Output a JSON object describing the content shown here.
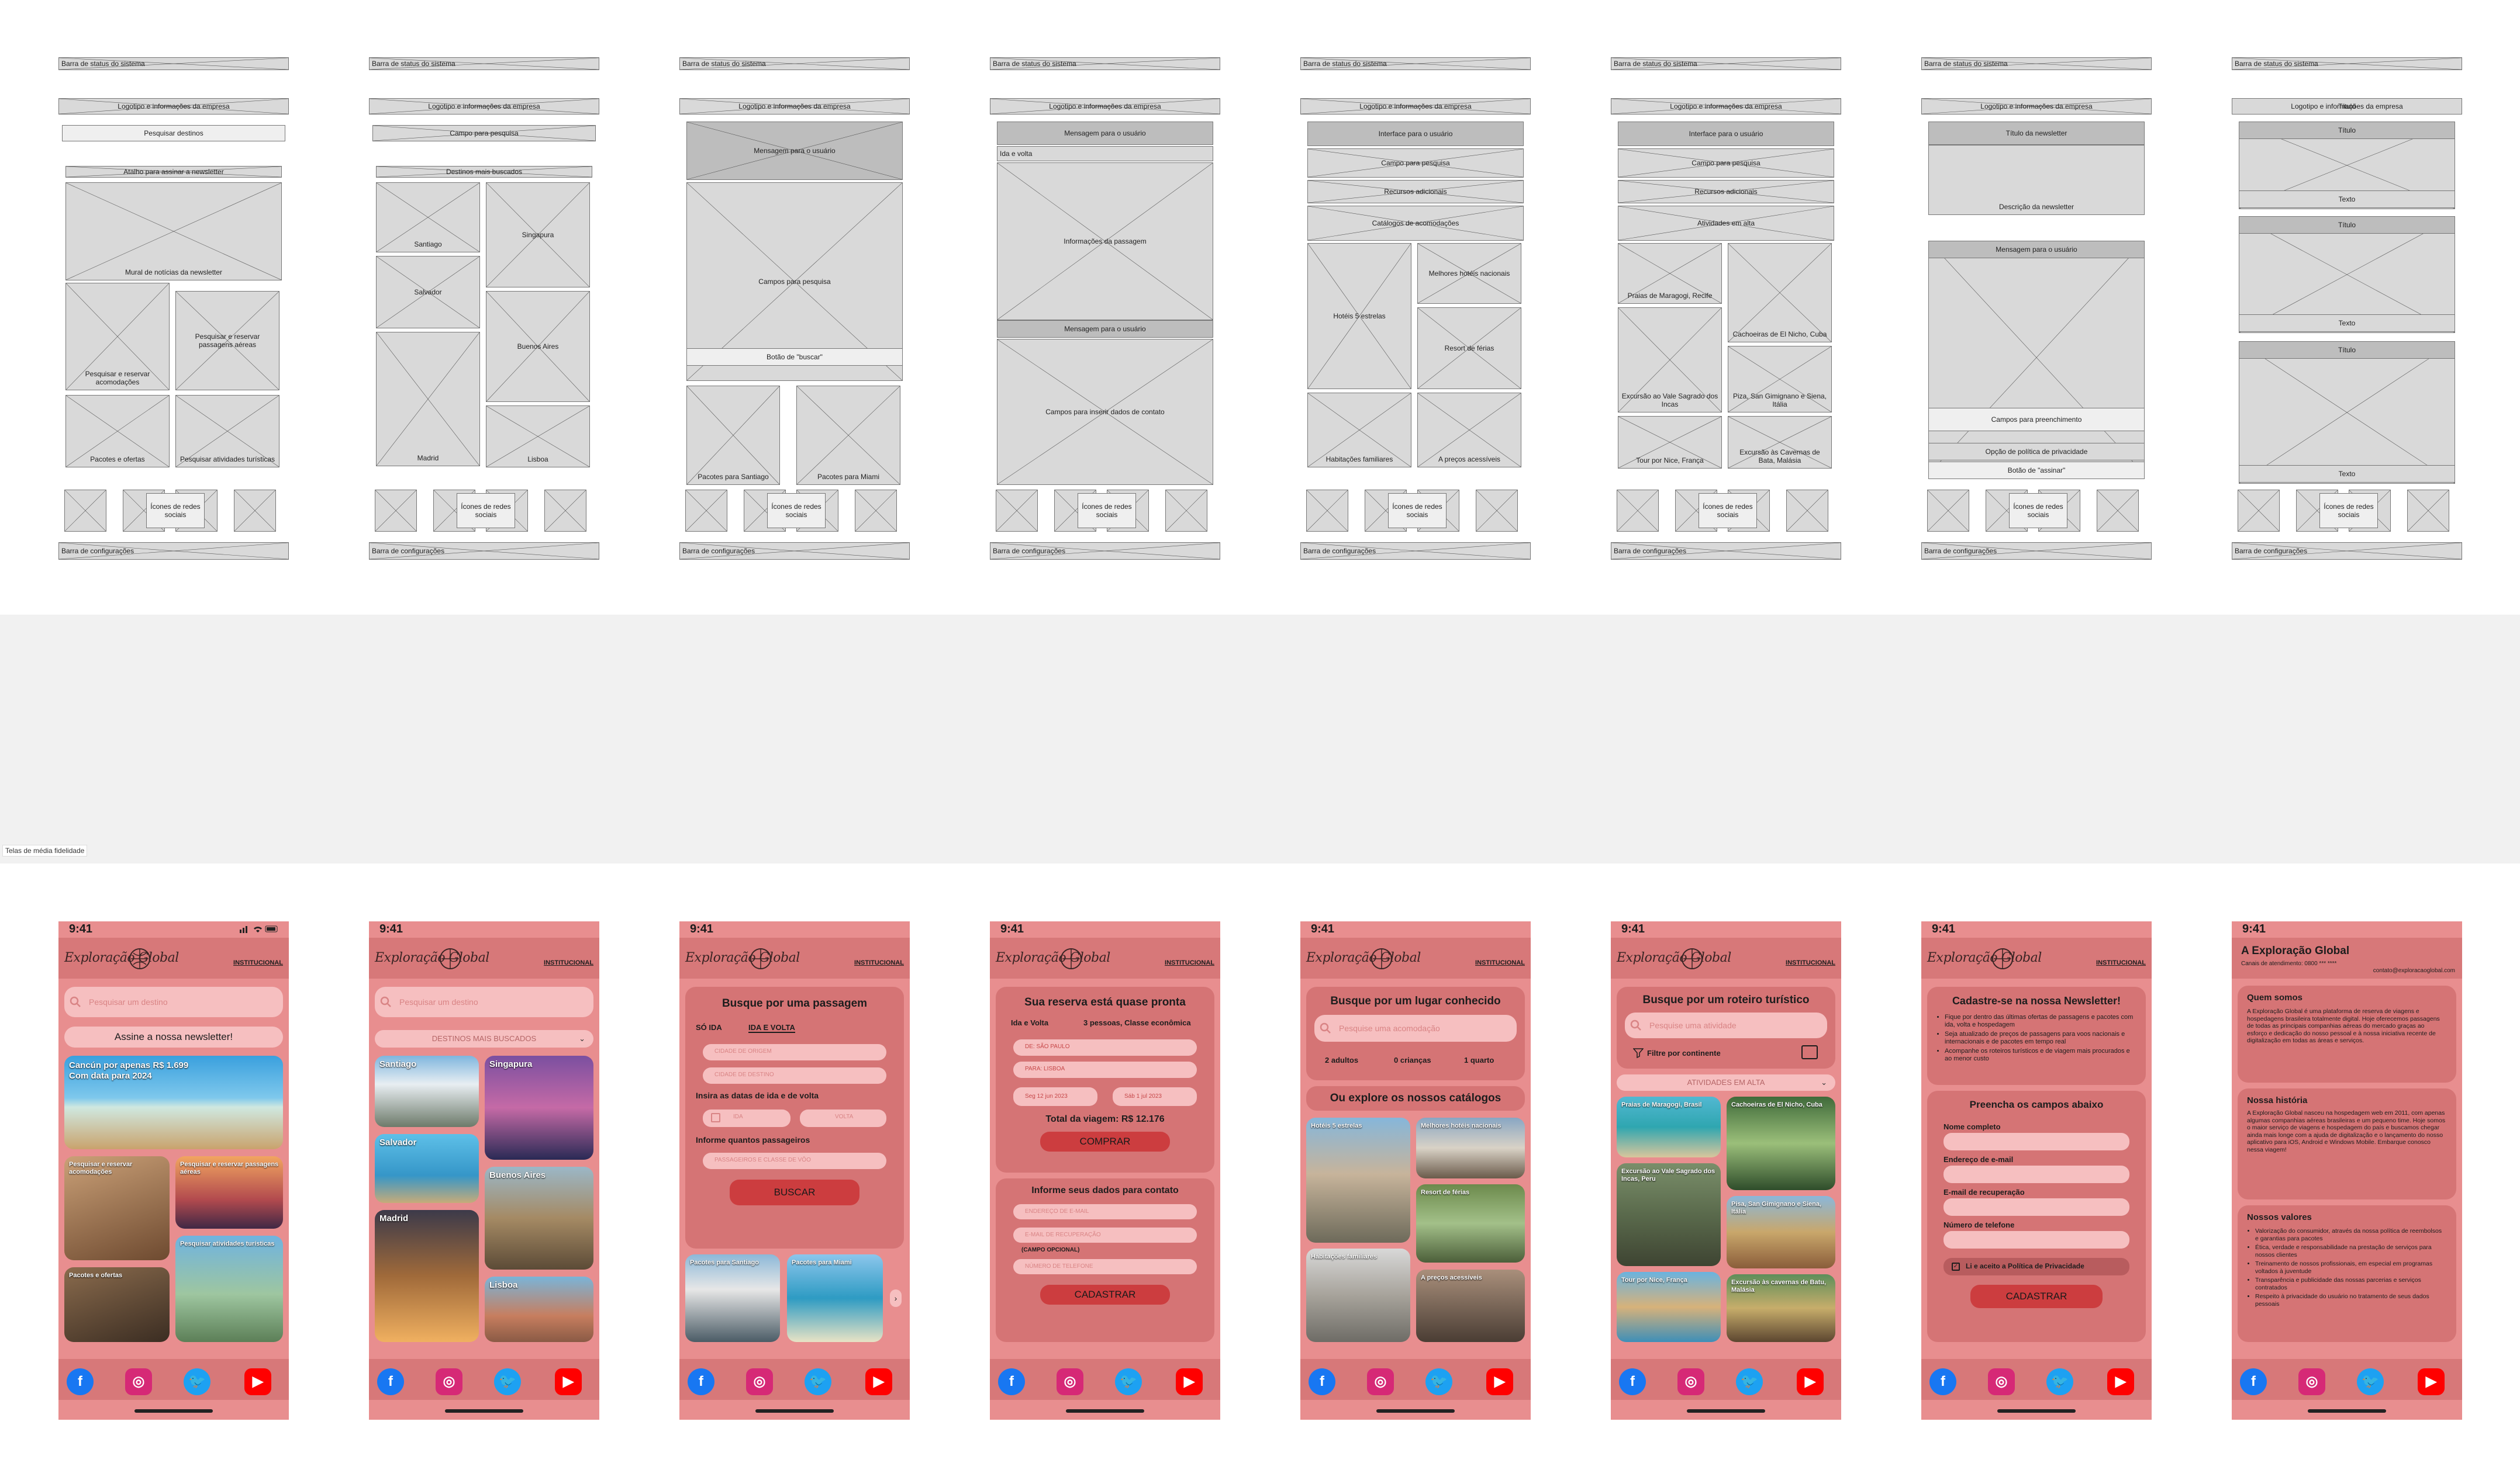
{
  "canvas": {
    "section_label": "Telas de média fidelidade"
  },
  "wireframes": {
    "system_bar": "Barra de status do sistema",
    "logo": "Logotipo e informações da empresa",
    "settings_bar": "Barra de configurações",
    "social": "Ícones de redes sociais",
    "w1": {
      "search": "Pesquisar destinos",
      "news_shortcut": "Atalho para assinar a newsletter",
      "mural": "Mural de notícias da newsletter",
      "tile_a": "Pesquisar e reservar acomodações",
      "tile_b": "Pesquisar e reservar passagens aéreas",
      "tile_c": "Pacotes e ofertas",
      "tile_d": "Pesquisar atividades turísticas"
    },
    "w2": {
      "search": "Campo para pesquisa",
      "dest": "Destinos mais buscados",
      "c1": "Santiago",
      "c2": "Singapura",
      "c3": "Salvador",
      "c4": "Buenos Aires",
      "c5": "Madrid",
      "c6": "Lisboa"
    },
    "w3": {
      "msg": "Mensagem para o usuário",
      "fields": "Campos para pesquisa",
      "btn": "Botão de \"buscar\"",
      "p1": "Pacotes para Santiago",
      "p2": "Pacotes para Miami"
    },
    "w4": {
      "msg": "Mensagem para o usuário",
      "trip": "Ida e volta",
      "pax": "3 pessoas, Classe econômica",
      "info": "Informações da passagem",
      "msg2": "Mensagem para o usuário",
      "contact": "Campos para inserir dados de contato"
    },
    "w5": {
      "iface": "Interface para o usuário",
      "search": "Campo para pesquisa",
      "extra": "Recursos adicionais",
      "catalogs": "Catálogos de acomodações",
      "h1": "Hotéis 5 estrelas",
      "h2": "Melhores hotéis nacionais",
      "h3": "Resort de férias",
      "h4": "Habitações familiares",
      "h5": "A preços acessíveis"
    },
    "w6": {
      "iface": "Interface para o usuário",
      "search": "Campo para pesquisa",
      "extra": "Recursos adicionais",
      "hot": "Atividades em alta",
      "a1": "Praias de Maragogi, Recife",
      "a2": "Cachoeiras de El Nicho, Cuba",
      "a3": "Excursão ao Vale Sagrado dos Incas",
      "a4": "Piza, San Gimignano e Siena, Itália",
      "a5": "Tour por Nice, França",
      "a6": "Excursão às Cavernas de Bata, Malásia"
    },
    "w7": {
      "title": "Título da newsletter",
      "desc": "Descrição da newsletter",
      "msg": "Mensagem para o usuário",
      "fields": "Campos para preenchimento",
      "policy": "Opção de política de privacidade",
      "btn": "Botão de \"assinar\""
    },
    "w8": {
      "bar": "Título",
      "t1": "Título",
      "x1": "Texto",
      "t2": "Título",
      "x2": "Texto",
      "t3": "Título",
      "x3": "Texto"
    }
  },
  "hifi": {
    "time": "9:41",
    "brand": "Exploração Global",
    "institutional": "INSTITUCIONAL",
    "s1": {
      "search_ph": "Pesquisar um destino",
      "newsletter": "Assine a nossa newsletter!",
      "promo_title": "Cancún por apenas R$ 1.699",
      "promo_sub": "Com data para 2024",
      "t1": "Pesquisar e reservar acomodações",
      "t2": "Pesquisar e reservar passagens aéreas",
      "t3": "Pacotes e ofertas",
      "t4": "Pesquisar atividades turísticas"
    },
    "s2": {
      "search_ph": "Pesquisar um destino",
      "dropdown": "DESTINOS MAIS BUSCADOS",
      "c1": "Santiago",
      "c2": "Singapura",
      "c3": "Salvador",
      "c4": "Buenos Aires",
      "c5": "Madrid",
      "c6": "Lisboa"
    },
    "s3": {
      "title": "Busque por uma passagem",
      "tab1": "SÓ IDA",
      "tab2": "IDA E VOLTA",
      "f1": "CIDADE DE ORIGEM",
      "f2": "CIDADE DE DESTINO",
      "dates_label": "Insira as datas de ida e de volta",
      "d1": "IDA",
      "d2": "VOLTA",
      "pax_label": "Informe quantos passageiros",
      "f3": "PASSAGEIROS E CLASSE DE VÔO",
      "btn": "BUSCAR",
      "p1": "Pacotes para Santiago",
      "p2": "Pacotes para Miami"
    },
    "s4": {
      "title": "Sua reserva está quase pronta",
      "trip": "Ida e Volta",
      "pax": "3 pessoas, Classe econômica",
      "from": "DE: SÃO PAULO",
      "to": "PARA: LISBOA",
      "d1": "Seg 12 jun 2023",
      "d2": "Sáb 1 jul 2023",
      "total": "Total da viagem: R$ 12.176",
      "buy": "COMPRAR",
      "contact_title": "Informe seus dados para contato",
      "f1": "ENDEREÇO DE E-MAIL",
      "f2": "E-MAIL DE RECUPERAÇÃO",
      "optional": "(CAMPO OPCIONAL)",
      "f3": "NÚMERO DE TELEFONE",
      "btn": "CADASTRAR"
    },
    "s5": {
      "title": "Busque por um lugar conhecido",
      "search_ph": "Pesquise uma acomodação",
      "adults": "2 adultos",
      "children": "0 crianças",
      "rooms": "1 quarto",
      "catalogs": "Ou explore os nossos catálogos",
      "h1": "Hotéis 5 estrelas",
      "h2": "Melhores hotéis nacionais",
      "h3": "Resort de férias",
      "h4": "Habitações familiares",
      "h5": "A preços acessíveis"
    },
    "s6": {
      "title": "Busque por um roteiro turístico",
      "search_ph": "Pesquise uma atividade",
      "filter": "Filtre por continente",
      "hot": "ATIVIDADES EM ALTA",
      "a1": "Praias de Maragogi, Brasil",
      "a2": "Cachoeiras de El Nicho, Cuba",
      "a3": "Excursão ao Vale Sagrado dos Incas, Peru",
      "a4": "Pisa, San Gimignano e Siena, Itália",
      "a5": "Tour por Nice, França",
      "a6": "Excursão às cavernas de Batu, Malásia"
    },
    "s7": {
      "title": "Cadastre-se na nossa Newsletter!",
      "bullets": [
        "Fique por dentro das últimas ofertas de passagens e pacotes com ida, volta e hospedagem",
        "Seja atualizado de preços de passagens para voos nacionais e internacionais e de pacotes em tempo real",
        "Acompanhe os roteiros turísticos e de viagem mais procurados e ao menor custo"
      ],
      "fill": "Preencha os campos abaixo",
      "l1": "Nome completo",
      "l2": "Endereço de e-mail",
      "l3": "E-mail de recuperação",
      "l4": "Número de telefone",
      "policy": "Li e aceito a Política de Privacidade",
      "btn": "CADASTRAR"
    },
    "s8": {
      "title": "A Exploração Global",
      "phone": "Canais de atendimento: 0800 *** ****",
      "email": "contato@exploracaoglobal.com",
      "about_t": "Quem somos",
      "about": "A Exploração Global é uma plataforma de reserva de viagens e hospedagens brasileira totalmente digital. Hoje oferecemos passagens de todas as principais companhias aéreas do mercado graças ao esforço e dedicação do nosso pessoal e à nossa iniciativa recente de digitalização em todas as áreas e serviços.",
      "hist_t": "Nossa história",
      "hist": "A Exploração Global nasceu na hospedagem web em 2011, com apenas algumas companhias aéreas brasileiras e um pequeno time. Hoje somos o maior serviço de viagens e hospedagem do país e buscamos chegar ainda mais longe com a ajuda de digitalização e o lançamento do nosso aplicativo para iOS, Android e Windows Mobile. Embarque conosco nessa viagem!",
      "values_t": "Nossos valores",
      "values": [
        "Valorização do consumidor, através da nossa política de reembolsos e garantias para pacotes",
        "Ética, verdade e responsabilidade na prestação de serviços para nossos clientes",
        "Treinamento de nossos profissionais, em especial em programas voltados à juventude",
        "Transparência e publicidade das nossas parcerias e serviços contratados",
        "Respeito à privacidade do usuário no tratamento de seus dados pessoais"
      ]
    }
  }
}
